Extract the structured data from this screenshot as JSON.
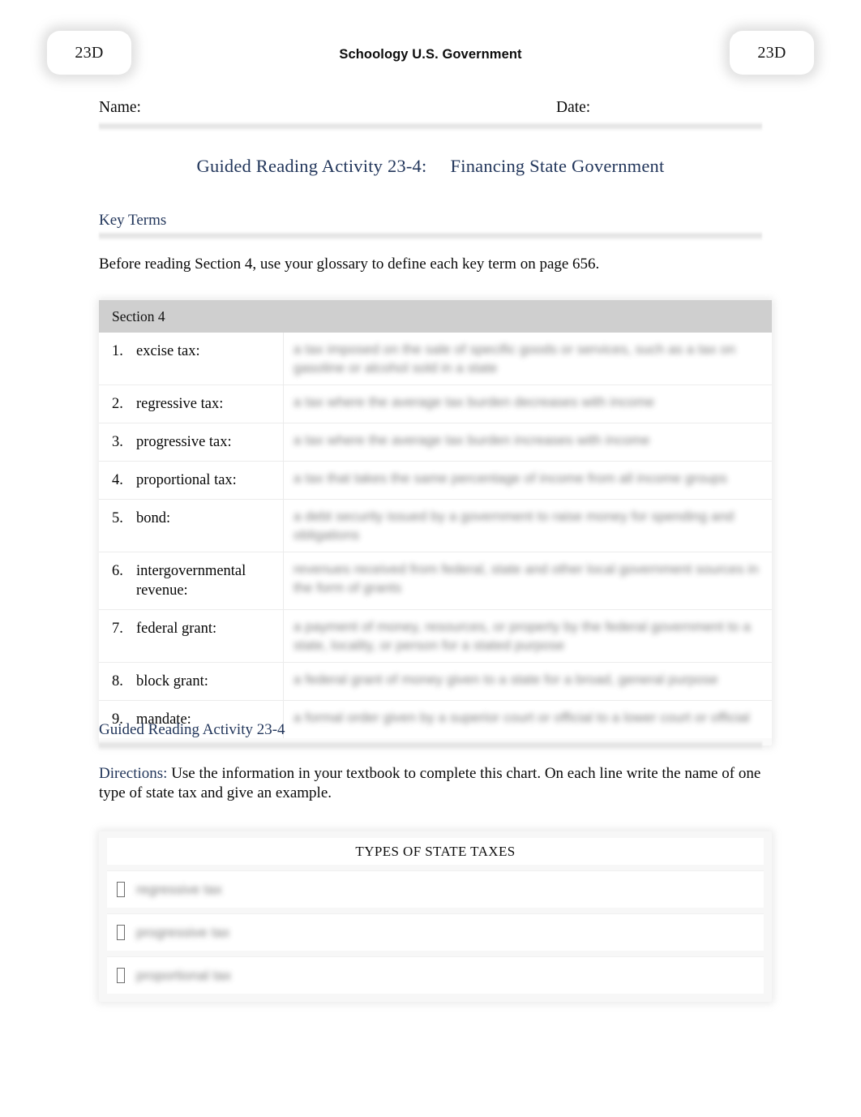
{
  "badges": {
    "left": "23D",
    "right": "23D"
  },
  "header": {
    "running_title": "Schoology U.S. Government"
  },
  "name_date": {
    "name_label": "Name:",
    "date_label": "Date:"
  },
  "title": {
    "text": "Guided Reading Activity 23-4:     Financing State Government"
  },
  "key_terms_section": {
    "heading": "Key Terms",
    "instruction": "Before reading Section 4, use your glossary to define each key term on page 656.",
    "table_header": "Section 4",
    "rows": [
      {
        "num": "1.",
        "term": "excise tax:",
        "answer": "a tax imposed on the sale of specific goods or services, such as a tax on gasoline or alcohol sold in a state"
      },
      {
        "num": "2.",
        "term": "regressive tax:",
        "answer": "a tax where the average tax burden decreases with income"
      },
      {
        "num": "3.",
        "term": "progressive tax:",
        "answer": "a tax where the average tax burden increases with income"
      },
      {
        "num": "4.",
        "term": "proportional tax:",
        "answer": "a tax that takes the same percentage of income from all income groups"
      },
      {
        "num": "5.",
        "term": "bond:",
        "answer": "a debt security issued by a government to raise money for spending and obligations"
      },
      {
        "num": "6.",
        "term": "intergovernmental revenue:",
        "answer": "revenues received from federal, state and other local government sources in the form of grants"
      },
      {
        "num": "7.",
        "term": "federal grant:",
        "answer": "a payment of money, resources, or property by the federal government to a state, locality, or person for a stated purpose"
      },
      {
        "num": "8.",
        "term": "block grant:",
        "answer": "a federal grant of money given to a state for a broad, general purpose"
      },
      {
        "num": "9.",
        "term": "mandate:",
        "answer": "a formal order given by a superior court or official to a lower court or official"
      }
    ]
  },
  "activity_section": {
    "heading": "Guided Reading Activity 23-4",
    "directions_label": "Directions:",
    "directions_text": "  Use the information in your textbook to complete this chart.    On each line write the name of one type of state tax and give an example.",
    "table_title": "TYPES OF STATE TAXES",
    "bullet_glyph": "tofu-box-bullet",
    "rows": [
      {
        "answer": "regressive tax"
      },
      {
        "answer": "progressive tax"
      },
      {
        "answer": "proportional tax"
      }
    ]
  },
  "colors": {
    "heading_navy": "#22365b",
    "body_black": "#0a0a0a",
    "table_header_gray": "#cfcfcf",
    "page_background": "#ffffff"
  }
}
